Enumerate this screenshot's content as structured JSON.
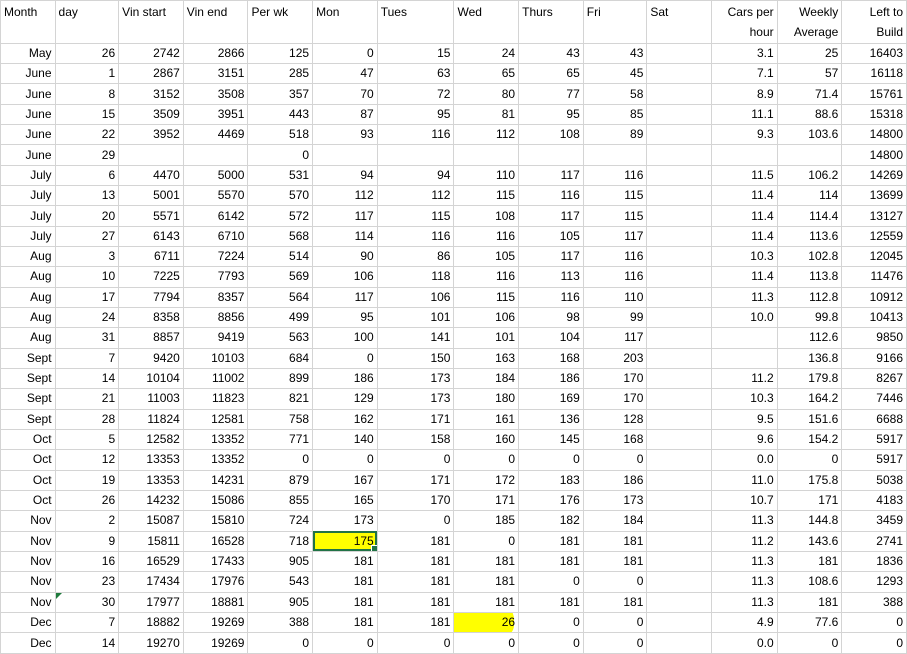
{
  "headers": [
    "Month",
    "day",
    "Vin start",
    "Vin end",
    "Per wk",
    "Mon",
    "Tues",
    "Wed",
    "Thurs",
    "Fri",
    "Sat",
    "Cars per hour",
    "Weekly Average",
    "Left to Build"
  ],
  "rows": [
    [
      "May",
      "26",
      "2742",
      "2866",
      "125",
      "0",
      "15",
      "24",
      "43",
      "43",
      "",
      "3.1",
      "25",
      "16403"
    ],
    [
      "June",
      "1",
      "2867",
      "3151",
      "285",
      "47",
      "63",
      "65",
      "65",
      "45",
      "",
      "7.1",
      "57",
      "16118"
    ],
    [
      "June",
      "8",
      "3152",
      "3508",
      "357",
      "70",
      "72",
      "80",
      "77",
      "58",
      "",
      "8.9",
      "71.4",
      "15761"
    ],
    [
      "June",
      "15",
      "3509",
      "3951",
      "443",
      "87",
      "95",
      "81",
      "95",
      "85",
      "",
      "11.1",
      "88.6",
      "15318"
    ],
    [
      "June",
      "22",
      "3952",
      "4469",
      "518",
      "93",
      "116",
      "112",
      "108",
      "89",
      "",
      "9.3",
      "103.6",
      "14800"
    ],
    [
      "June",
      "29",
      "",
      "",
      "0",
      "",
      "",
      "",
      "",
      "",
      "",
      "",
      "",
      "14800"
    ],
    [
      "July",
      "6",
      "4470",
      "5000",
      "531",
      "94",
      "94",
      "110",
      "117",
      "116",
      "",
      "11.5",
      "106.2",
      "14269"
    ],
    [
      "July",
      "13",
      "5001",
      "5570",
      "570",
      "112",
      "112",
      "115",
      "116",
      "115",
      "",
      "11.4",
      "114",
      "13699"
    ],
    [
      "July",
      "20",
      "5571",
      "6142",
      "572",
      "117",
      "115",
      "108",
      "117",
      "115",
      "",
      "11.4",
      "114.4",
      "13127"
    ],
    [
      "July",
      "27",
      "6143",
      "6710",
      "568",
      "114",
      "116",
      "116",
      "105",
      "117",
      "",
      "11.4",
      "113.6",
      "12559"
    ],
    [
      "Aug",
      "3",
      "6711",
      "7224",
      "514",
      "90",
      "86",
      "105",
      "117",
      "116",
      "",
      "10.3",
      "102.8",
      "12045"
    ],
    [
      "Aug",
      "10",
      "7225",
      "7793",
      "569",
      "106",
      "118",
      "116",
      "113",
      "116",
      "",
      "11.4",
      "113.8",
      "11476"
    ],
    [
      "Aug",
      "17",
      "7794",
      "8357",
      "564",
      "117",
      "106",
      "115",
      "116",
      "110",
      "",
      "11.3",
      "112.8",
      "10912"
    ],
    [
      "Aug",
      "24",
      "8358",
      "8856",
      "499",
      "95",
      "101",
      "106",
      "98",
      "99",
      "",
      "10.0",
      "99.8",
      "10413"
    ],
    [
      "Aug",
      "31",
      "8857",
      "9419",
      "563",
      "100",
      "141",
      "101",
      "104",
      "117",
      "",
      "",
      "112.6",
      "9850"
    ],
    [
      "Sept",
      "7",
      "9420",
      "10103",
      "684",
      "0",
      "150",
      "163",
      "168",
      "203",
      "",
      "",
      "136.8",
      "9166"
    ],
    [
      "Sept",
      "14",
      "10104",
      "11002",
      "899",
      "186",
      "173",
      "184",
      "186",
      "170",
      "",
      "11.2",
      "179.8",
      "8267"
    ],
    [
      "Sept",
      "21",
      "11003",
      "11823",
      "821",
      "129",
      "173",
      "180",
      "169",
      "170",
      "",
      "10.3",
      "164.2",
      "7446"
    ],
    [
      "Sept",
      "28",
      "11824",
      "12581",
      "758",
      "162",
      "171",
      "161",
      "136",
      "128",
      "",
      "9.5",
      "151.6",
      "6688"
    ],
    [
      "Oct",
      "5",
      "12582",
      "13352",
      "771",
      "140",
      "158",
      "160",
      "145",
      "168",
      "",
      "9.6",
      "154.2",
      "5917"
    ],
    [
      "Oct",
      "12",
      "13353",
      "13352",
      "0",
      "0",
      "0",
      "0",
      "0",
      "0",
      "",
      "0.0",
      "0",
      "5917"
    ],
    [
      "Oct",
      "19",
      "13353",
      "14231",
      "879",
      "167",
      "171",
      "172",
      "183",
      "186",
      "",
      "11.0",
      "175.8",
      "5038"
    ],
    [
      "Oct",
      "26",
      "14232",
      "15086",
      "855",
      "165",
      "170",
      "171",
      "176",
      "173",
      "",
      "10.7",
      "171",
      "4183"
    ],
    [
      "Nov",
      "2",
      "15087",
      "15810",
      "724",
      "173",
      "0",
      "185",
      "182",
      "184",
      "",
      "11.3",
      "144.8",
      "3459"
    ],
    [
      "Nov",
      "9",
      "15811",
      "16528",
      "718",
      "175",
      "181",
      "0",
      "181",
      "181",
      "",
      "11.2",
      "143.6",
      "2741"
    ],
    [
      "Nov",
      "16",
      "16529",
      "17433",
      "905",
      "181",
      "181",
      "181",
      "181",
      "181",
      "",
      "11.3",
      "181",
      "1836"
    ],
    [
      "Nov",
      "23",
      "17434",
      "17976",
      "543",
      "181",
      "181",
      "181",
      "0",
      "0",
      "",
      "11.3",
      "108.6",
      "1293"
    ],
    [
      "Nov",
      "30",
      "17977",
      "18881",
      "905",
      "181",
      "181",
      "181",
      "181",
      "181",
      "",
      "11.3",
      "181",
      "388"
    ],
    [
      "Dec",
      "7",
      "18882",
      "19269",
      "388",
      "181",
      "181",
      "26",
      "0",
      "0",
      "",
      "4.9",
      "77.6",
      "0"
    ],
    [
      "Dec",
      "14",
      "19270",
      "19269",
      "0",
      "0",
      "0",
      "0",
      "0",
      "0",
      "",
      "0.0",
      "0",
      "0"
    ]
  ],
  "selected_cell": {
    "row": 24,
    "col": 5
  },
  "highlight_color": "#ffff00",
  "selection_color": "#217346"
}
